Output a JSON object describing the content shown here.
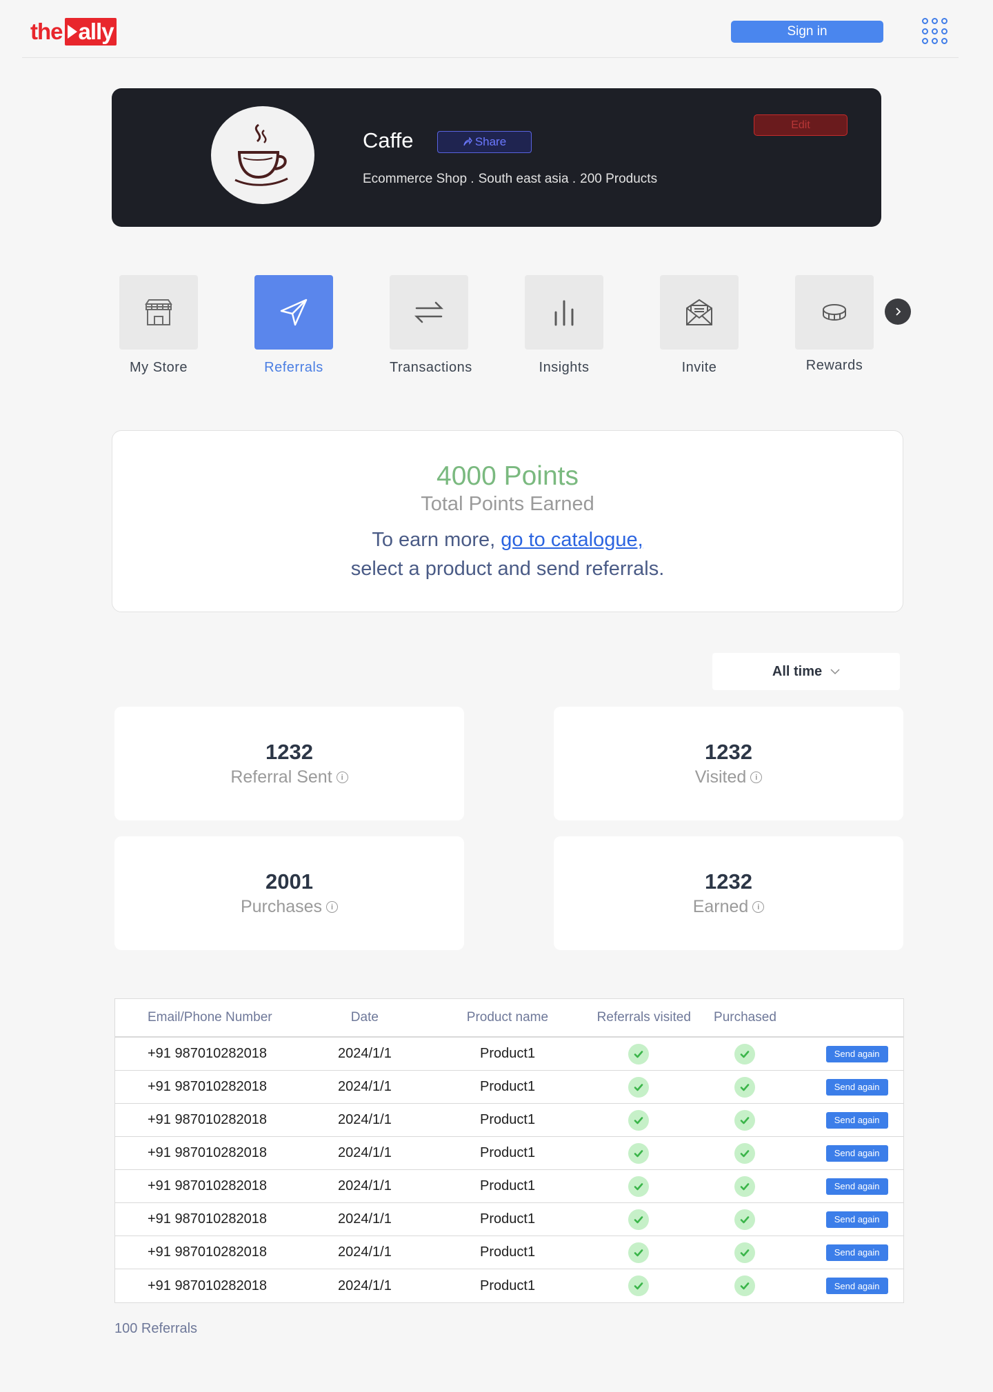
{
  "header": {
    "logo_text_left": "the",
    "logo_text_right": "ally",
    "signin_label": "Sign in",
    "apps_icon": "apps-grid-icon"
  },
  "profile": {
    "name": "Caffe",
    "share_label": "Share",
    "edit_label": "Edit",
    "meta": [
      "Ecommerce Shop .",
      "South east asia .",
      "200 Products"
    ],
    "avatar_icon": "coffee-cup-icon"
  },
  "nav": {
    "items": [
      {
        "label": "My Store",
        "icon": "store-icon",
        "active": false
      },
      {
        "label": "Referrals",
        "icon": "send-icon",
        "active": true
      },
      {
        "label": "Transactions",
        "icon": "swap-arrows-icon",
        "active": false
      },
      {
        "label": "Insights",
        "icon": "bar-chart-icon",
        "active": false
      },
      {
        "label": "Invite",
        "icon": "mail-icon",
        "active": false
      },
      {
        "label": "Rewards",
        "icon": "coin-icon",
        "active": false
      }
    ]
  },
  "points": {
    "value": "4000 Points",
    "subtitle": "Total Points Earned",
    "cta_prefix": "To earn more,",
    "cta_link": "go to catalogue,",
    "cta_suffix": "select a product and send referrals."
  },
  "filter": {
    "selected": "All time"
  },
  "stats": [
    {
      "value": "1232",
      "label": "Referral Sent"
    },
    {
      "value": "1232",
      "label": "Visited"
    },
    {
      "value": "2001",
      "label": "Purchases"
    },
    {
      "value": "1232",
      "label": "Earned"
    }
  ],
  "table": {
    "headers": [
      "Email/Phone Number",
      "Date",
      "Product name",
      "Referrals visited",
      "Purchased"
    ],
    "rows": [
      {
        "contact": "+91 987010282018",
        "date": "2024/1/1",
        "product": "Product1",
        "visited": true,
        "purchased": true,
        "action": "Send again"
      },
      {
        "contact": "+91 987010282018",
        "date": "2024/1/1",
        "product": "Product1",
        "visited": true,
        "purchased": true,
        "action": "Send again"
      },
      {
        "contact": "+91 987010282018",
        "date": "2024/1/1",
        "product": "Product1",
        "visited": true,
        "purchased": true,
        "action": "Send again"
      },
      {
        "contact": "+91 987010282018",
        "date": "2024/1/1",
        "product": "Product1",
        "visited": true,
        "purchased": true,
        "action": "Send again"
      },
      {
        "contact": "+91 987010282018",
        "date": "2024/1/1",
        "product": "Product1",
        "visited": true,
        "purchased": true,
        "action": "Send again"
      },
      {
        "contact": "+91 987010282018",
        "date": "2024/1/1",
        "product": "Product1",
        "visited": true,
        "purchased": true,
        "action": "Send again"
      },
      {
        "contact": "+91 987010282018",
        "date": "2024/1/1",
        "product": "Product1",
        "visited": true,
        "purchased": true,
        "action": "Send again"
      },
      {
        "contact": "+91 987010282018",
        "date": "2024/1/1",
        "product": "Product1",
        "visited": true,
        "purchased": true,
        "action": "Send again"
      }
    ],
    "footer": "100 Referrals"
  },
  "colors": {
    "accent": "#4a86ee",
    "active_tile": "#5a86ec",
    "points_green": "#7ab97f",
    "brand_red": "#e8262c",
    "profile_bg": "#1d1f26"
  }
}
